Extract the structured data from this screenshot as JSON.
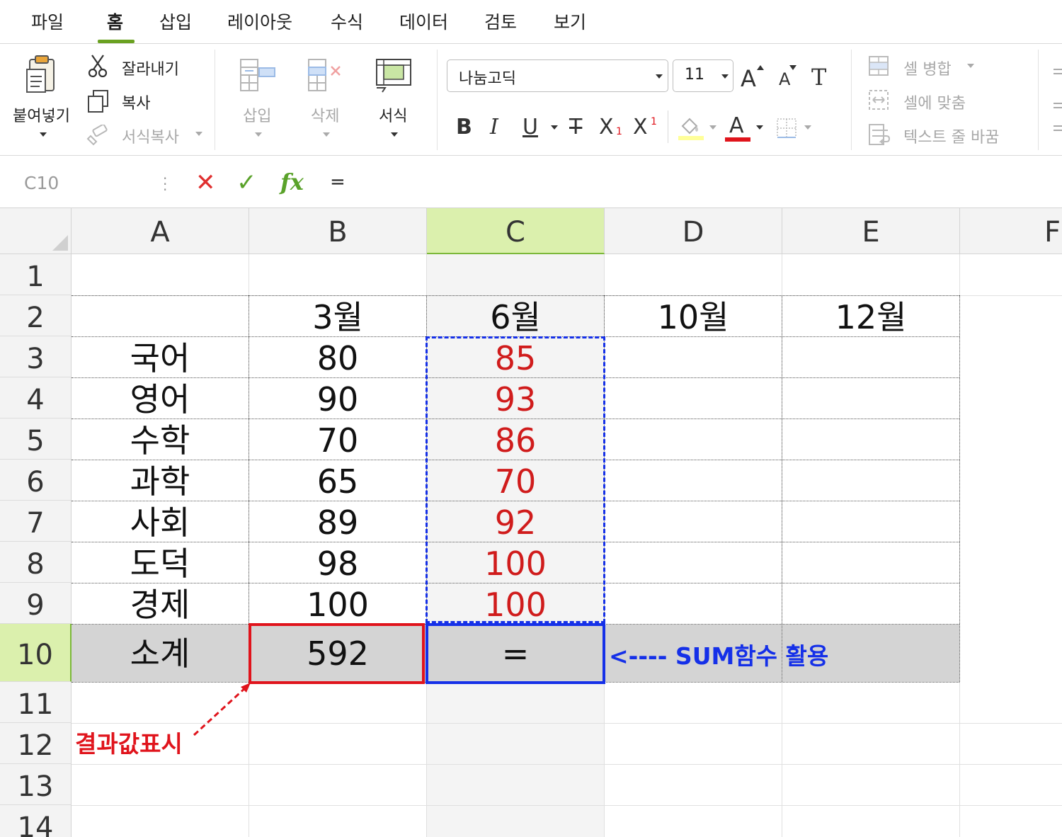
{
  "menu": {
    "tabs": [
      "파일",
      "홈",
      "삽입",
      "레이아웃",
      "수식",
      "데이터",
      "검토",
      "보기"
    ],
    "active": "홈"
  },
  "ribbon": {
    "paste_label": "붙여넣기",
    "cut_label": "잘라내기",
    "copy_label": "복사",
    "format_painter_label": "서식복사",
    "insert_label": "삽입",
    "delete_label": "삭제",
    "format_label": "서식",
    "font_name": "나눔고딕",
    "font_size": "11",
    "bold": "B",
    "italic": "I",
    "underline": "U",
    "strike": "T",
    "subscript": "X",
    "subscript_mark": "1",
    "superscript": "X",
    "superscript_mark": "1",
    "font_color_glyph": "A",
    "grow_glyph": "A",
    "shrink_glyph": "A",
    "clear_glyph": "T",
    "merge_label": "셀 병합",
    "fit_label": "셀에 맞춤",
    "wrap_label": "텍스트 줄 바꿈",
    "colors": {
      "highlight": "#ffff99",
      "font": "#e0141c",
      "accent": "#6aa121"
    }
  },
  "formula_bar": {
    "cell_ref": "C10",
    "cancel_glyph": "✕",
    "confirm_glyph": "✓",
    "fx": "fx",
    "value": "="
  },
  "sheet": {
    "columns": [
      "A",
      "B",
      "C",
      "D",
      "E",
      "F"
    ],
    "selected_column": "C",
    "rows": [
      "1",
      "2",
      "3",
      "4",
      "5",
      "6",
      "7",
      "8",
      "9",
      "10",
      "11",
      "12",
      "13",
      "14"
    ],
    "selected_row": "10",
    "headers": [
      "3월",
      "6월",
      "10월",
      "12월"
    ],
    "subjects": [
      "국어",
      "영어",
      "수학",
      "과학",
      "사회",
      "도덕",
      "경제"
    ],
    "march": [
      "80",
      "90",
      "70",
      "65",
      "89",
      "98",
      "100"
    ],
    "june": [
      "85",
      "93",
      "86",
      "70",
      "92",
      "100",
      "100"
    ],
    "total_label": "소계",
    "total_b": "592",
    "total_c": "="
  },
  "annotations": {
    "sum_note": "<---- SUM함수 활용",
    "result_note": "결과값표시"
  }
}
